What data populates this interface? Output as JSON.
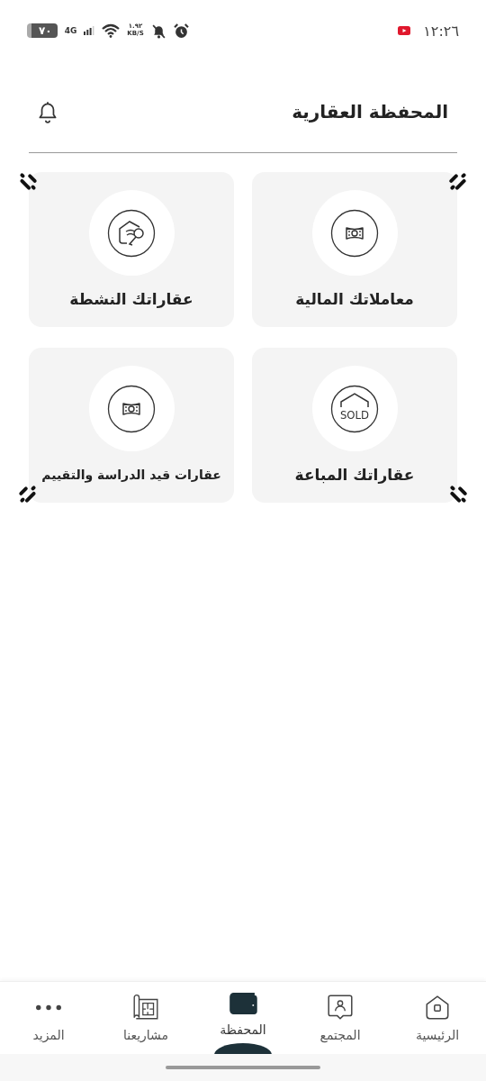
{
  "status_bar": {
    "time": "١٢:٢٦",
    "network": "4G",
    "speed": "١.٩٢",
    "speed_unit": "KB/S",
    "battery": "٧٠"
  },
  "header": {
    "title": "المحفظة العقارية"
  },
  "cards": [
    {
      "label": "معاملاتك المالية"
    },
    {
      "label": "عقاراتك النشطة"
    },
    {
      "label": "عقاراتك المباعة",
      "badge": "SOLD"
    },
    {
      "label": "عقارات قيد الدراسة والتقييم"
    }
  ],
  "nav": [
    {
      "label": "الرئيسية",
      "selected": false
    },
    {
      "label": "المجتمع",
      "selected": false
    },
    {
      "label": "المحفظة",
      "selected": true
    },
    {
      "label": "مشاريعنا",
      "selected": false
    },
    {
      "label": "المزيد",
      "selected": false
    }
  ]
}
